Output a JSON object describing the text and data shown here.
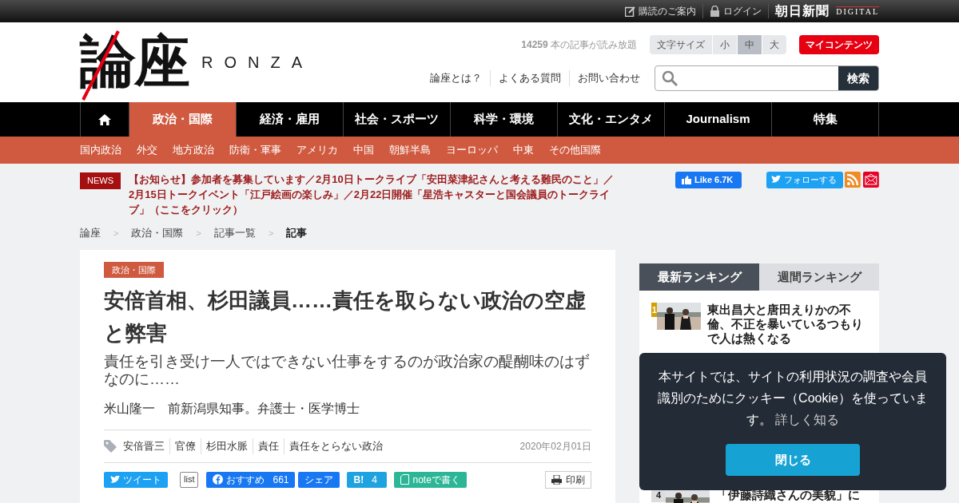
{
  "top_bar": {
    "links": [
      {
        "label": "購読のご案内",
        "kind": "subscribe"
      },
      {
        "label": "ログイン",
        "kind": "login"
      }
    ],
    "brand": {
      "name": "朝日新聞",
      "sub": "DIGITAL"
    }
  },
  "header": {
    "logo": {
      "name": "論座",
      "roman": "RONZA"
    },
    "article_count": "14259",
    "article_count_text": "本の記事が読み放題",
    "font_size": {
      "label": "文字サイズ",
      "options": [
        {
          "label": "小",
          "selected": false
        },
        {
          "label": "中",
          "selected": true
        },
        {
          "label": "大",
          "selected": false
        }
      ]
    },
    "my_contents": "マイコンテンツ",
    "links": [
      "論座とは？",
      "よくある質問",
      "お問い合わせ"
    ],
    "search": {
      "button": "検索"
    }
  },
  "nav": {
    "items": [
      {
        "kind": "home",
        "selected": false
      },
      {
        "kind": "text",
        "label": "政治・国際",
        "selected": true
      },
      {
        "kind": "text",
        "label": "経済・雇用",
        "selected": false
      },
      {
        "kind": "text",
        "label": "社会・スポーツ",
        "selected": false
      },
      {
        "kind": "text",
        "label": "科学・環境",
        "selected": false
      },
      {
        "kind": "text",
        "label": "文化・エンタメ",
        "selected": false
      },
      {
        "kind": "text",
        "label": "Journalism",
        "selected": false
      },
      {
        "kind": "text",
        "label": "特集",
        "selected": false
      }
    ]
  },
  "sub_nav": {
    "items": [
      "国内政治",
      "外交",
      "地方政治",
      "防衛・軍事",
      "アメリカ",
      "中国",
      "朝鮮半島",
      "ヨーロッパ",
      "中東",
      "その他国際"
    ]
  },
  "news": {
    "badge": "NEWS",
    "text": "【お知らせ】参加者を募集しています／2月10日トークライブ「安田菜津紀さんと考える難民のこと」／2月15日トークイベント「江戸絵画の楽しみ」／2月22日開催「星浩キャスターと国会議員のトークライブ」（ここをクリック）"
  },
  "social": {
    "facebook": {
      "label": "Like",
      "count": "6.7K"
    },
    "twitter": {
      "label": "フォローする"
    }
  },
  "breadcrumb": {
    "separator": ">",
    "items": [
      {
        "label": "論座",
        "current": false
      },
      {
        "label": "政治・国際",
        "current": false
      },
      {
        "label": "記事一覧",
        "current": false
      },
      {
        "label": "記事",
        "current": true
      }
    ]
  },
  "article": {
    "category": "政治・国際",
    "title": "安倍首相、杉田議員……責任を取らない政治の空虚と弊害",
    "subtitle": "責任を引き受け一人ではできない仕事をするのが政治家の醍醐味のはずなのに……",
    "author": "米山隆一　前新潟県知事。弁護士・医学博士",
    "tags": [
      "安倍晋三",
      "官僚",
      "杉田水脈",
      "責任",
      "責任をとらない政治"
    ],
    "date": "2020年02月01日",
    "share": [
      {
        "kind": "tweet",
        "label": "ツイート"
      },
      {
        "kind": "callout",
        "label": "list"
      },
      {
        "kind": "facebook",
        "label": "おすすめ",
        "count": "661"
      },
      {
        "kind": "share",
        "label": "シェア"
      },
      {
        "kind": "hatena",
        "label": "B!",
        "count": "4"
      },
      {
        "kind": "note",
        "label": "noteで書く"
      }
    ],
    "print": "印刷"
  },
  "ranking": {
    "tabs": [
      {
        "label": "最新ランキング",
        "selected": true
      },
      {
        "label": "週間ランキング",
        "selected": false
      }
    ],
    "items": [
      {
        "rank": "1",
        "color": "#d4a000",
        "title": "東出昌大と唐田えりかの不倫、不正を暴いているつもりで人は熱くなる"
      },
      {
        "rank": "4",
        "color": "#dddddd",
        "title": "「伊藤詩織さんの美貌」に"
      }
    ]
  },
  "cookie": {
    "text": "本サイトでは、サイトの利用状況の調査や会員識別のためにクッキー（Cookie）を使っています。",
    "link": "詳しく知る",
    "button": "閉じる"
  }
}
